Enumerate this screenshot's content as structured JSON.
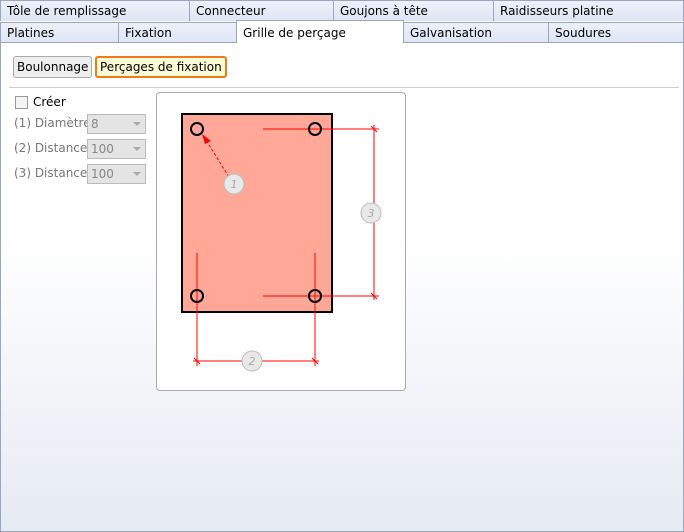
{
  "tabs_row1": [
    "Tôle de remplissage",
    "Connecteur",
    "Goujons à tête",
    "Raidisseurs platine"
  ],
  "tabs_row2": [
    "Platines",
    "Fixation",
    "Grille de perçage",
    "Galvanisation",
    "Soudures"
  ],
  "active_tab": "Grille de perçage",
  "subtabs": {
    "bolting": "Boulonnage",
    "fixing_holes": "Perçages de fixation"
  },
  "create": {
    "label": "Créer",
    "checked": false
  },
  "fields": [
    {
      "label": "(1) Diamètre:",
      "value": "8"
    },
    {
      "label": "(2) Distance:",
      "value": "100"
    },
    {
      "label": "(3) Distance:",
      "value": "100"
    }
  ],
  "diagram": {
    "markers": [
      "1",
      "2",
      "3"
    ],
    "plate_color": "#ffa898",
    "dim_color": "#ff0000"
  },
  "colors": {
    "accent": "#f07a1a"
  }
}
